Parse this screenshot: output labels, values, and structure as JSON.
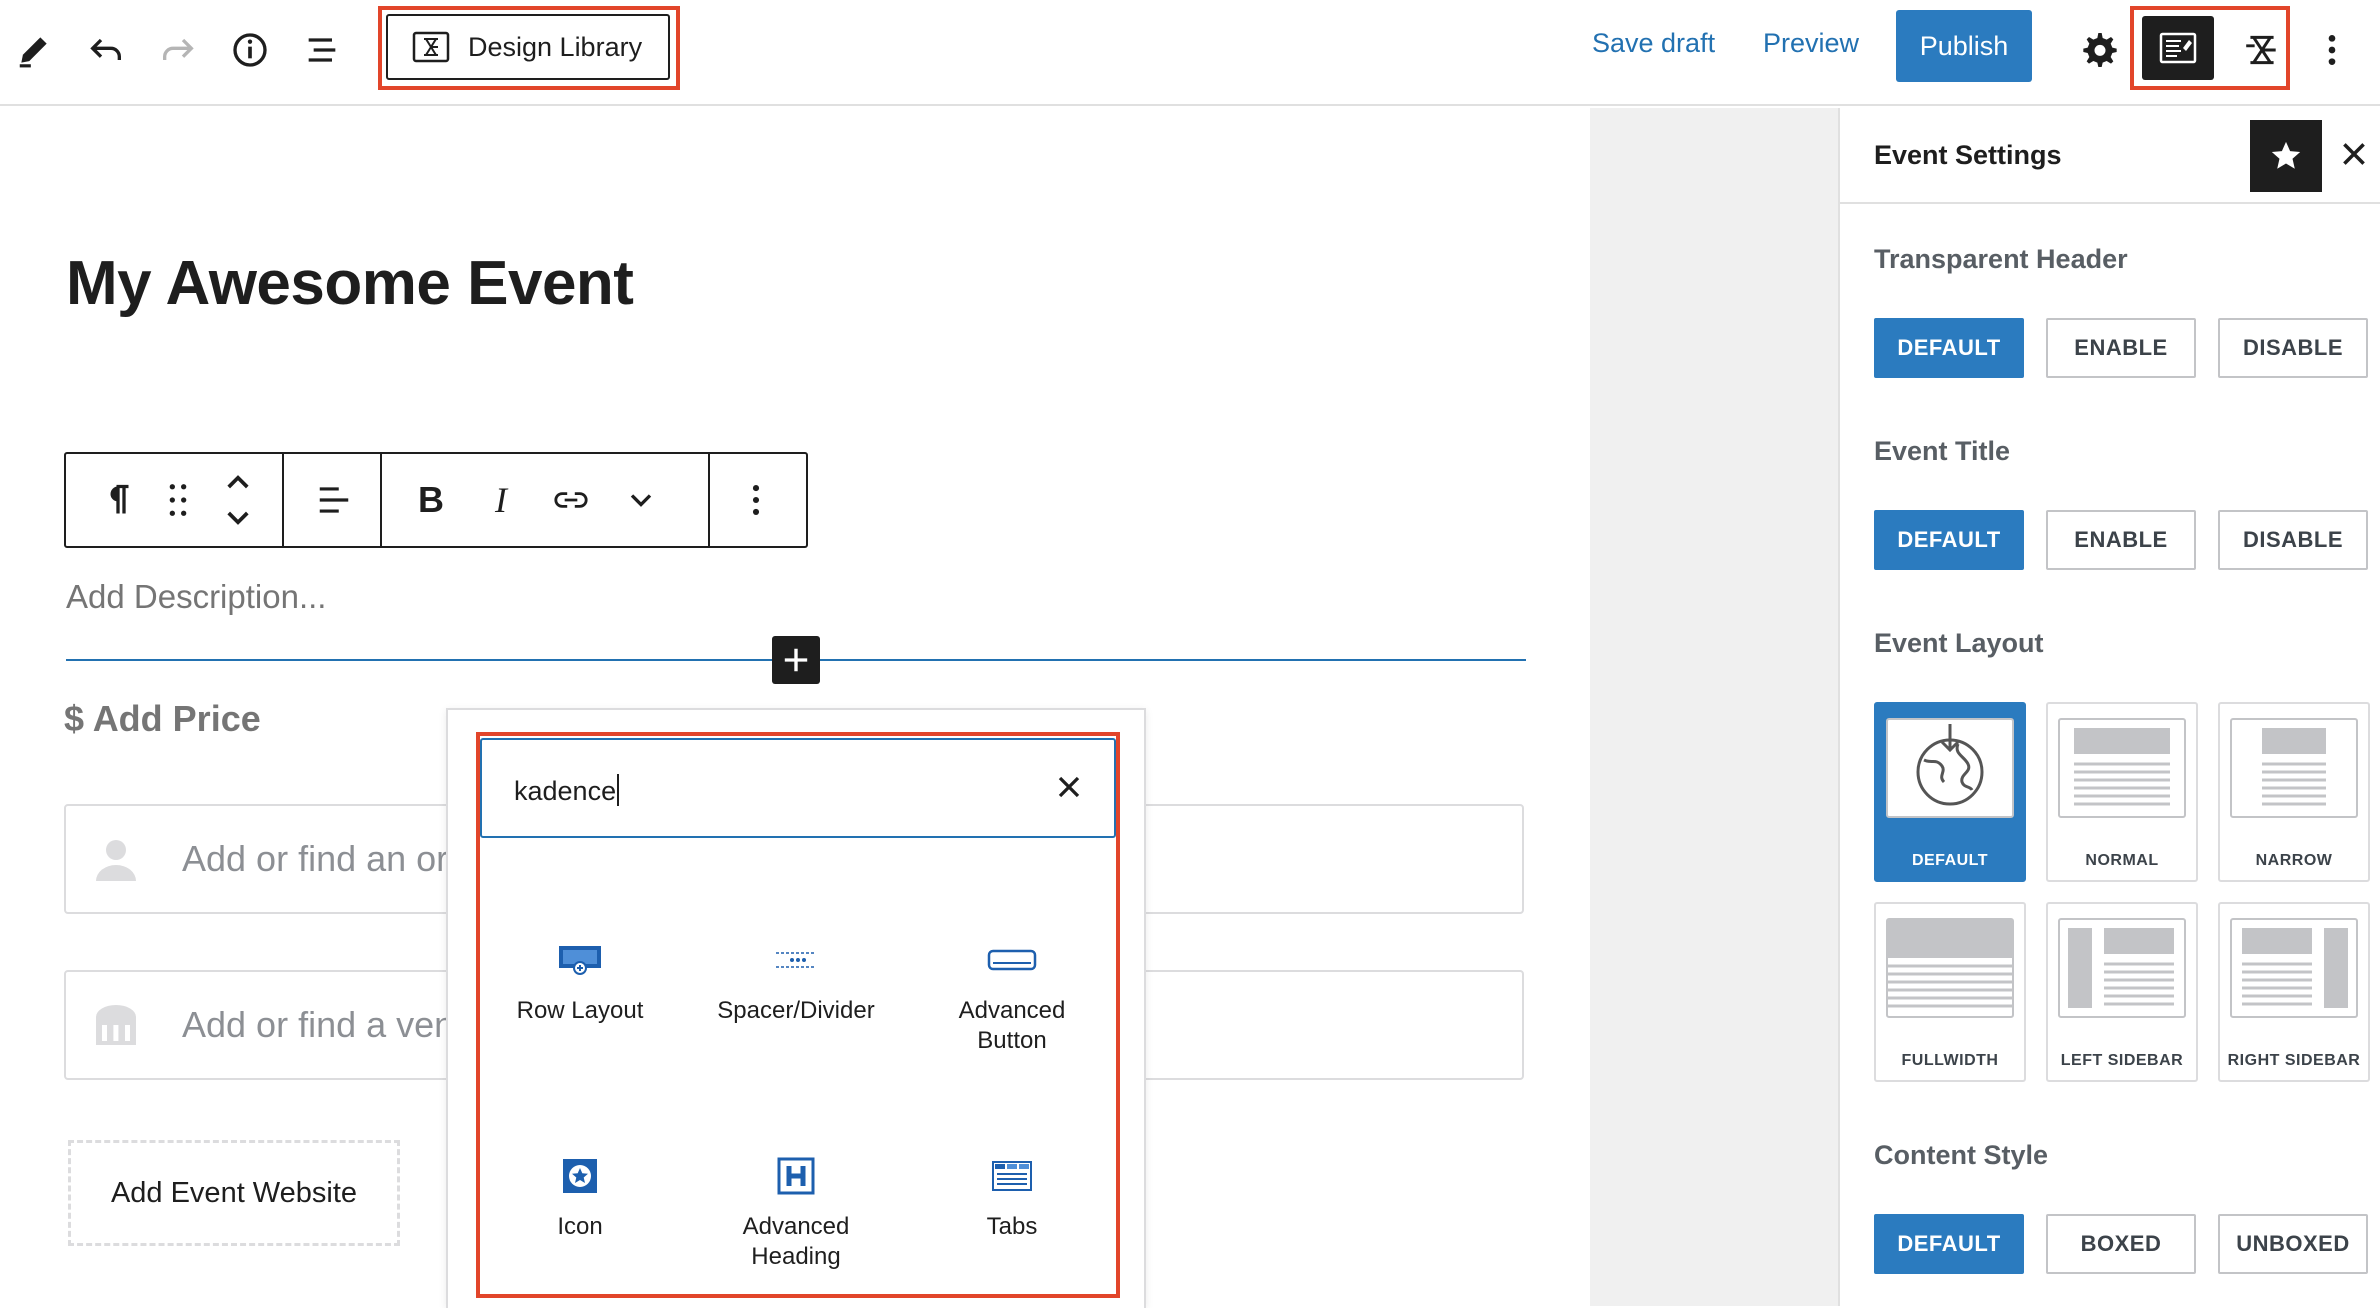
{
  "toolbar": {
    "design_library_label": "Design Library",
    "save_draft_label": "Save draft",
    "preview_label": "Preview",
    "publish_label": "Publish",
    "icons": [
      "pencil-icon",
      "undo-icon",
      "redo-icon",
      "info-icon",
      "list-view-icon",
      "kadence-design-library-icon",
      "settings-gear-icon",
      "event-settings-panel-icon",
      "kadence-icon",
      "more-options-icon"
    ]
  },
  "editor": {
    "post_title": "My Awesome Event",
    "description_placeholder": "Add Description...",
    "price_placeholder": "$ Add Price",
    "organizer_placeholder": "Add or find an org",
    "venue_placeholder": "Add or find a venu",
    "website_button": "Add Event Website"
  },
  "inserter": {
    "search_value": "kadence",
    "blocks": [
      {
        "label": "Row Layout",
        "icon": "row-layout-icon"
      },
      {
        "label": "Spacer/Divider",
        "icon": "spacer-divider-icon"
      },
      {
        "label": "Advanced Button",
        "icon": "advanced-button-icon"
      },
      {
        "label": "Icon",
        "icon": "icon-block-icon"
      },
      {
        "label": "Advanced Heading",
        "icon": "advanced-heading-icon"
      },
      {
        "label": "Tabs",
        "icon": "tabs-icon"
      }
    ]
  },
  "sidebar": {
    "title": "Event Settings",
    "transparent_header": {
      "label": "Transparent Header",
      "options": [
        "DEFAULT",
        "ENABLE",
        "DISABLE"
      ],
      "selected": "DEFAULT"
    },
    "event_title": {
      "label": "Event Title",
      "options": [
        "DEFAULT",
        "ENABLE",
        "DISABLE"
      ],
      "selected": "DEFAULT"
    },
    "event_layout": {
      "label": "Event Layout",
      "options": [
        "DEFAULT",
        "NORMAL",
        "NARROW",
        "FULLWIDTH",
        "LEFT SIDEBAR",
        "RIGHT SIDEBAR"
      ],
      "selected": "DEFAULT"
    },
    "content_style": {
      "label": "Content Style",
      "options": [
        "DEFAULT",
        "BOXED",
        "UNBOXED"
      ],
      "selected": "DEFAULT"
    }
  },
  "colors": {
    "accent": "#2b7bbf",
    "link": "#2271b1",
    "highlight": "#e2452a",
    "dark": "#1e1e1e"
  }
}
